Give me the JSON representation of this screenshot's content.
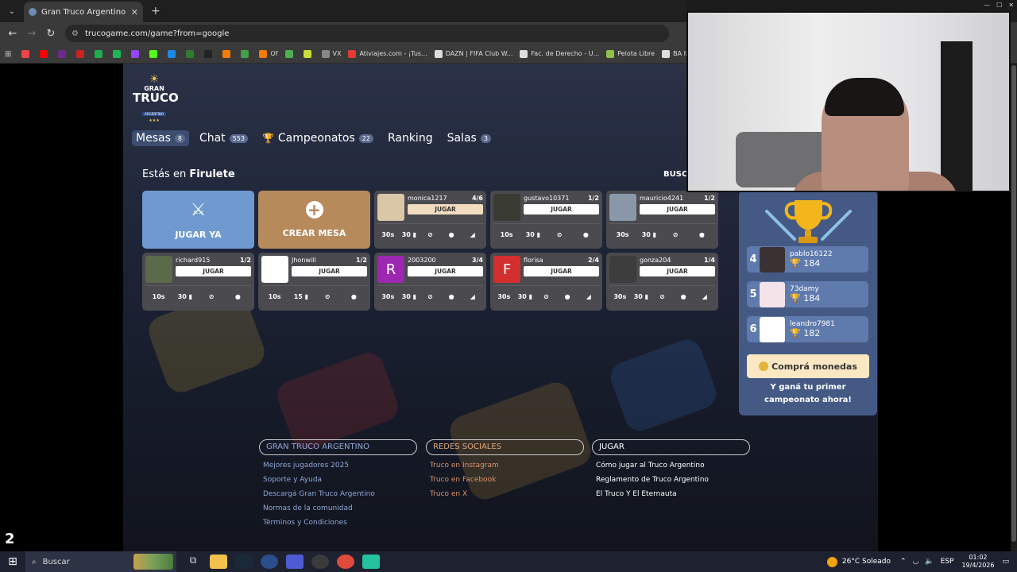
{
  "browser": {
    "tab_title": "Gran Truco Argentino - Juego",
    "url": "trucogame.com/game?from=google",
    "bookmarks": [
      {
        "label": "",
        "color": "#e44"
      },
      {
        "label": "",
        "color": "#f00"
      },
      {
        "label": "",
        "color": "#6c2b8a"
      },
      {
        "label": "",
        "color": "#c22"
      },
      {
        "label": "",
        "color": "#1fae4b"
      },
      {
        "label": "",
        "color": "#1db954"
      },
      {
        "label": "",
        "color": "#9146ff"
      },
      {
        "label": "",
        "color": "#53fc18"
      },
      {
        "label": "",
        "color": "#1e88e5"
      },
      {
        "label": "",
        "color": "#2e7d32"
      },
      {
        "label": "",
        "color": "#222"
      },
      {
        "label": "",
        "color": "#f57c00"
      },
      {
        "label": "",
        "color": "#43a047"
      },
      {
        "label": "Of",
        "color": "#f57c00"
      },
      {
        "label": "",
        "color": "#4caf50"
      },
      {
        "label": "",
        "color": "#cddc39"
      },
      {
        "label": "VX",
        "color": "#888"
      },
      {
        "label": "Ativiajes.com - ¡Tus...",
        "color": "#e53935"
      },
      {
        "label": "DAZN | FIFA Club W...",
        "color": "#ddd"
      },
      {
        "label": "Fac. de Derecho - U...",
        "color": "#ddd"
      },
      {
        "label": "Pelota Libre",
        "color": "#8bc34a"
      },
      {
        "label": "BA IMPORT",
        "color": "#ddd"
      }
    ]
  },
  "logo": {
    "line1": "GRAN",
    "line2": "TRUCO",
    "line3": "ARGENTINO",
    "stars": "★★★"
  },
  "nav": {
    "tabs": [
      {
        "label": "Mesas",
        "badge": "8"
      },
      {
        "label": "Chat",
        "badge": "553"
      },
      {
        "label": "Campeonatos",
        "badge": "22"
      },
      {
        "label": "Ranking",
        "badge": ""
      },
      {
        "label": "Salas",
        "badge": "3"
      }
    ]
  },
  "location": {
    "prefix": "Estás en",
    "room": "Firulete"
  },
  "buscar": "BUSCA",
  "actions": {
    "play": "JUGAR YA",
    "create": "CREAR MESA"
  },
  "tables": [
    {
      "name": "monica1217",
      "count": "4/6",
      "join": "JUGAR",
      "time": "30s",
      "points": "30",
      "avatar": "",
      "avatar_color": "#d9c7a8",
      "highlight": true
    },
    {
      "name": "gustavo10371",
      "count": "1/2",
      "join": "JUGAR",
      "time": "10s",
      "points": "30",
      "avatar": "",
      "avatar_color": "#3a3b32",
      "highlight": false
    },
    {
      "name": "mauricio4241",
      "count": "1/2",
      "join": "JUGAR",
      "time": "30s",
      "points": "30",
      "avatar": "",
      "avatar_color": "#8a97a8",
      "highlight": false
    },
    {
      "name": "richard915",
      "count": "1/2",
      "join": "JUGAR",
      "time": "10s",
      "points": "30",
      "avatar": "",
      "avatar_color": "#5b6a4a",
      "highlight": false
    },
    {
      "name": "Jhonwill",
      "count": "1/2",
      "join": "JUGAR",
      "time": "10s",
      "points": "15",
      "avatar": "",
      "avatar_color": "#ffffff",
      "highlight": false
    },
    {
      "name": "2003200",
      "count": "3/4",
      "join": "JUGAR",
      "time": "30s",
      "points": "30",
      "avatar": "R",
      "avatar_color": "#9c27b0",
      "highlight": false
    },
    {
      "name": "florisa",
      "count": "2/4",
      "join": "JUGAR",
      "time": "30s",
      "points": "30",
      "avatar": "F",
      "avatar_color": "#d32f2f",
      "highlight": false
    },
    {
      "name": "gonza204",
      "count": "1/4",
      "join": "JUGAR",
      "time": "30s",
      "points": "30",
      "avatar": "",
      "avatar_color": "#3d3d3d",
      "highlight": false
    }
  ],
  "ranking": [
    {
      "pos": "4",
      "name": "pablo16122",
      "points": "184",
      "pic_color": "#3a3232"
    },
    {
      "pos": "5",
      "name": "73damy",
      "points": "184",
      "pic_color": "#f4e3e8"
    },
    {
      "pos": "6",
      "name": "leandro7981",
      "points": "182",
      "pic_color": "#ffffff"
    }
  ],
  "shop": {
    "button": "Comprá monedas",
    "promo": "Y ganá tu primer campeonato ahora!"
  },
  "footer": {
    "col1": {
      "title": "GRAN TRUCO ARGENTINO",
      "links": [
        "Mejores jugadores 2025",
        "Soporte y Ayuda",
        "Descargá Gran Truco Argentino",
        "Normas de la comunidad",
        "Términos y Condiciones"
      ]
    },
    "col2": {
      "title": "REDES SOCIALES",
      "links": [
        "Truco en Instagram",
        "Truco en Facebook",
        "Truco en X"
      ]
    },
    "col3": {
      "title": "JUGAR",
      "links": [
        "Cómo jugar al Truco Argentino",
        "Reglamento de Truco Argentino",
        "El Truco Y El Eternauta"
      ]
    }
  },
  "overlay_number": "2",
  "taskbar": {
    "search": "Buscar",
    "weather": "26°C Soleado",
    "lang": "ESP",
    "time": "01:02",
    "date": "19/4/2026"
  }
}
